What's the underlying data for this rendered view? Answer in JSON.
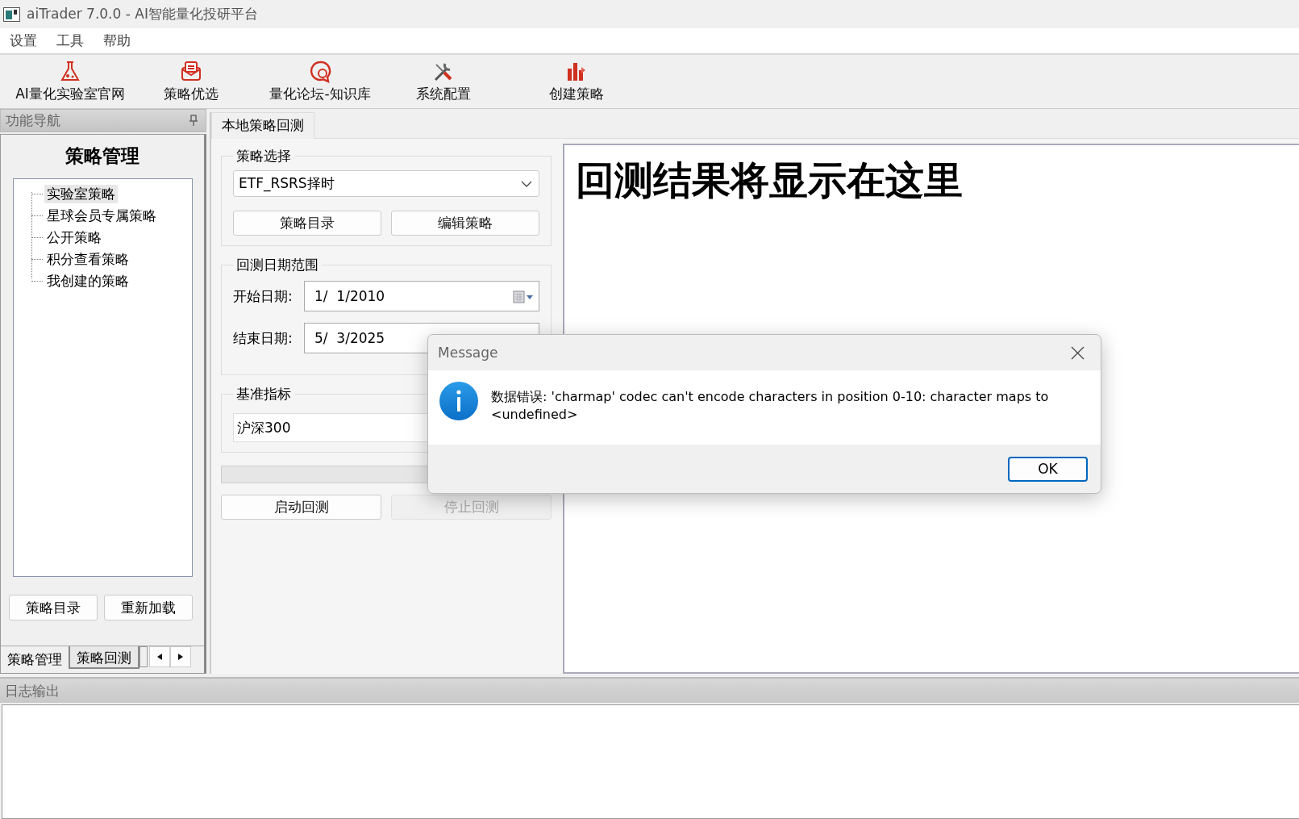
{
  "window": {
    "title": "aiTrader 7.0.0 - AI智能量化投研平台"
  },
  "menu": [
    {
      "label": "设置"
    },
    {
      "label": "工具"
    },
    {
      "label": "帮助"
    }
  ],
  "toolbar": [
    {
      "label": "AI量化实验室官网",
      "kind": "flask"
    },
    {
      "label": "策略优选",
      "kind": "envelope"
    },
    {
      "label": "量化论坛-知识库",
      "kind": "bubble"
    },
    {
      "label": "系统配置",
      "kind": "tools"
    },
    {
      "label": "创建策略",
      "kind": "chart"
    }
  ],
  "nav_dock": {
    "title": "功能导航",
    "heading": "策略管理",
    "tree": [
      {
        "label": "实验室策略",
        "selected": true
      },
      {
        "label": "星球会员专属策略",
        "selected": false
      },
      {
        "label": "公开策略",
        "selected": false
      },
      {
        "label": "积分查看策略",
        "selected": false
      },
      {
        "label": "我创建的策略",
        "selected": false
      }
    ],
    "buttons": [
      "策略目录",
      "重新加载"
    ],
    "tabs": [
      {
        "label": "策略管理",
        "selected": true
      },
      {
        "label": "策略回测",
        "selected": false
      }
    ]
  },
  "workspace": {
    "tabs": [
      {
        "label": "本地策略回测",
        "selected": true
      }
    ],
    "strategy_group": {
      "title": "策略选择",
      "dropdown": "ETF_RSRS择时",
      "buttons": [
        "策略目录",
        "编辑策略"
      ]
    },
    "date_group": {
      "title": "回测日期范围",
      "fields": [
        {
          "label": "开始日期:",
          "value": "1/  1/2010"
        },
        {
          "label": "结束日期:",
          "value": "5/  3/2025"
        }
      ]
    },
    "benchmark_group": {
      "title": "基准指标",
      "value": "沪深300"
    },
    "progress": {
      "level": 0
    },
    "actions": [
      {
        "label": "启动回测",
        "disabled": false
      },
      {
        "label": "停止回测",
        "disabled": true
      }
    ],
    "result_text": "回测结果将显示在这里"
  },
  "log_dock": {
    "title": "日志输出"
  },
  "dialog": {
    "title": "Message",
    "message": "数据错误: 'charmap' codec can't encode characters in position 0-10: character maps to <undefined>",
    "button": "OK"
  }
}
